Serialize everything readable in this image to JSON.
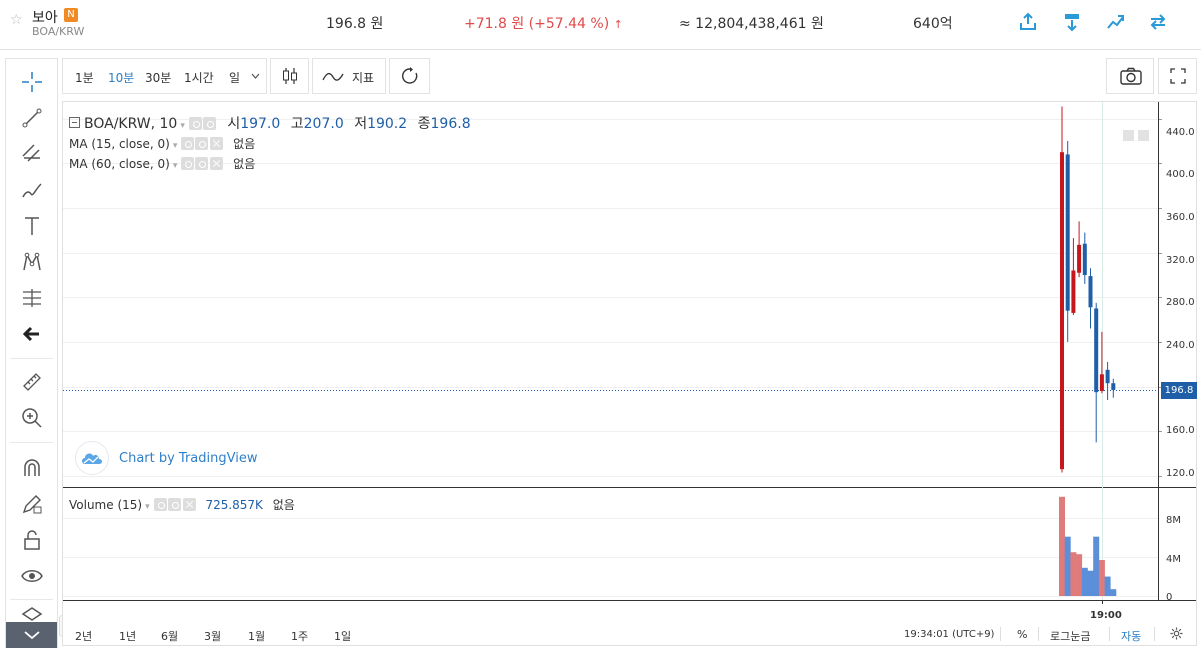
{
  "header": {
    "name": "보아",
    "badge": "N",
    "pair": "BOA/KRW",
    "price": "196.8 원",
    "change": "+71.8 원 (+57.44 %)",
    "change_arrow": "↑",
    "volume": "≈ 12,804,438,461 원",
    "market_cap": "640억"
  },
  "toolbar": {
    "intervals": [
      "1분",
      "10분",
      "30분",
      "1시간",
      "일"
    ],
    "indicators_label": "지표"
  },
  "legend": {
    "symbol": "BOA/KRW, 10",
    "open_label": "시",
    "open": "197.0",
    "high_label": "고",
    "high": "207.0",
    "low_label": "저",
    "low": "190.2",
    "close_label": "종",
    "close": "196.8",
    "ma1": "MA (15, close, 0)",
    "ma1_value": "없음",
    "ma2": "MA (60, close, 0)",
    "ma2_value": "없음",
    "volume": "Volume (15)",
    "volume_value": "725.857K",
    "volume_ma": "없음"
  },
  "watermark": "Chart by TradingView",
  "axis": {
    "price_ticks": [
      "440.0",
      "400.0",
      "360.0",
      "320.0",
      "280.0",
      "240.0",
      "200.0",
      "160.0",
      "120.0"
    ],
    "last_price": "196.8",
    "volume_ticks": [
      "8M",
      "4M",
      "0"
    ],
    "time_label": "19:00"
  },
  "bottom": {
    "ranges": [
      "2년",
      "1년",
      "6월",
      "3월",
      "1월",
      "1주",
      "1일"
    ],
    "clock": "19:34:01 (UTC+9)",
    "percent": "%",
    "log": "로그눈금",
    "auto": "자동"
  },
  "colors": {
    "up": "#c8161d",
    "down": "#1f5fa8",
    "vol_up": "#e07b7b",
    "vol_down": "#5b8fd9",
    "accent": "#2a7ec4"
  },
  "chart_data": {
    "type": "candlestick",
    "price_axis": {
      "min": 110,
      "max": 455
    },
    "candles": [
      {
        "open": 126,
        "high": 451,
        "low": 123,
        "close": 410
      },
      {
        "open": 408,
        "high": 420,
        "low": 240,
        "close": 268
      },
      {
        "open": 266,
        "high": 333,
        "low": 264,
        "close": 304
      },
      {
        "open": 302,
        "high": 348,
        "low": 298,
        "close": 327
      },
      {
        "open": 328,
        "high": 338,
        "low": 292,
        "close": 300
      },
      {
        "open": 299,
        "high": 306,
        "low": 252,
        "close": 271
      },
      {
        "open": 270,
        "high": 275,
        "low": 150,
        "close": 195
      },
      {
        "open": 196,
        "high": 249,
        "low": 194,
        "close": 211
      },
      {
        "open": 215,
        "high": 222,
        "low": 188,
        "close": 203
      },
      {
        "open": 203,
        "high": 207,
        "low": 190,
        "close": 197
      }
    ],
    "volume_axis": {
      "max": 11000000
    },
    "volumes": [
      10200000,
      6100000,
      4500000,
      4300000,
      2900000,
      2600000,
      6100000,
      3700000,
      2000000,
      700000
    ],
    "volume_up": [
      true,
      false,
      true,
      true,
      false,
      false,
      false,
      true,
      false,
      false
    ]
  }
}
